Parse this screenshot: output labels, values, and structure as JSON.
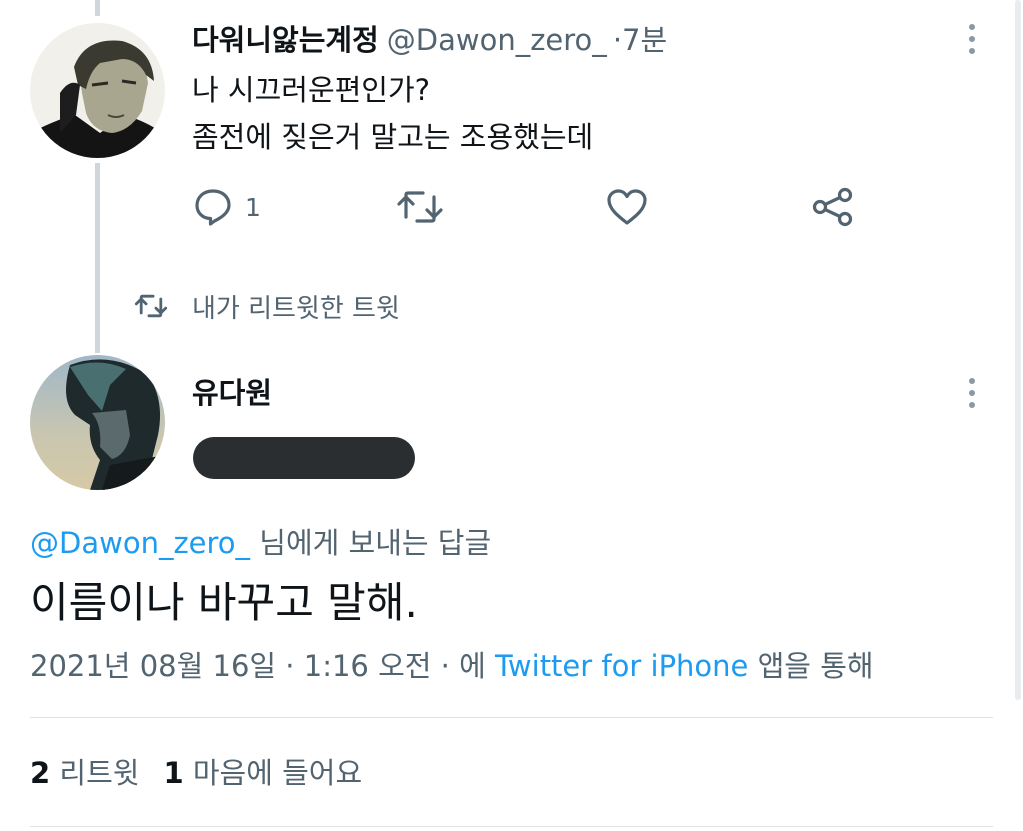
{
  "tweet1": {
    "display_name": "다워니앓는계정",
    "handle": "@Dawon_zero_",
    "separator": "·",
    "time": "7분",
    "lines": [
      "나 시끄러운편인가?",
      "좀전에 짖은거 말고는 조용했는데"
    ],
    "actions": {
      "reply_icon": "reply-icon",
      "reply_count": "1",
      "retweet_icon": "retweet-icon",
      "like_icon": "heart-icon",
      "share_icon": "share-icon"
    }
  },
  "retweet_context": {
    "icon": "retweet-icon",
    "text": "내가 리트윗한 트윗"
  },
  "tweet2": {
    "display_name": "유다원",
    "reply_prefix_handle": "@Dawon_zero_",
    "reply_suffix": "님에게 보내는 답글",
    "text": "이름이나 바꾸고 말해.",
    "meta_date": "2021년 08월 16일 · 1:16 오전 · 에",
    "meta_source": "Twitter for iPhone",
    "meta_suffix": "앱을 통해",
    "retweets_count": "2",
    "retweets_label": "리트윗",
    "likes_count": "1",
    "likes_label": "마음에 들어요"
  },
  "colors": {
    "link": "#1d9bf0",
    "secondary_text": "#536471",
    "thread_line": "#d0d5d9",
    "redacted": "#2b2e31"
  }
}
